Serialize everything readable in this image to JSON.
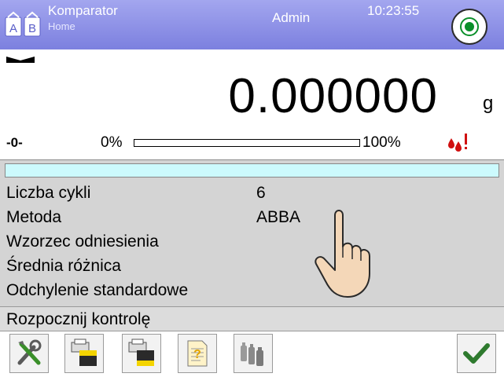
{
  "header": {
    "title": "Komparator",
    "subtitle": "Home",
    "user": "Admin",
    "time": "10:23:55",
    "app_icon_letters": [
      "A",
      "B"
    ],
    "colors": {
      "bar_top": "#a3a6ef",
      "bar_bottom": "#7c80df",
      "home_green": "#0a8f2a"
    }
  },
  "display": {
    "weight": "0.000000",
    "unit": "g",
    "zero_indicator": "-0-",
    "range_min_label": "0%",
    "range_max_label": "100%",
    "load_fraction": 0.0,
    "icons": [
      "stability-icon",
      "zero-icon",
      "drops-alert-icon"
    ]
  },
  "info": {
    "bar_color": "#ccfafd",
    "rows": [
      {
        "label": "Liczba cykli",
        "value": "6"
      },
      {
        "label": "Metoda",
        "value": "ABBA"
      },
      {
        "label": "Wzorzec odniesienia",
        "value": ""
      },
      {
        "label": "Średnia różnica",
        "value": ""
      },
      {
        "label": "Odchylenie standardowe",
        "value": ""
      }
    ]
  },
  "action": {
    "label": "Rozpocznij kontrolę"
  },
  "footer": {
    "buttons": [
      "settings-icon",
      "printer-header-icon",
      "printer-footer-icon",
      "report-icon",
      "weights-icon",
      "confirm-check-icon"
    ]
  }
}
